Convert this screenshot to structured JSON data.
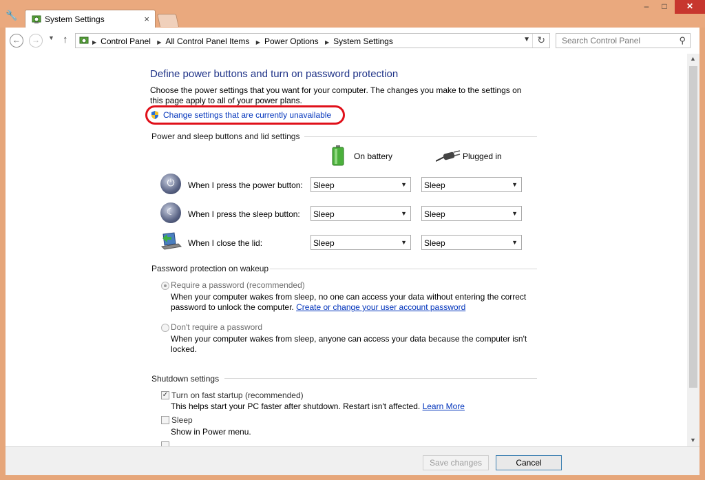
{
  "window": {
    "tab_title": "System Settings",
    "close_tab": "×",
    "minimize": "–",
    "maximize": "□",
    "close": "✕"
  },
  "nav": {
    "breadcrumbs": [
      "Control Panel",
      "All Control Panel Items",
      "Power Options",
      "System Settings"
    ],
    "search_placeholder": "Search Control Panel"
  },
  "page": {
    "heading": "Define power buttons and turn on password protection",
    "description": "Choose the power settings that you want for your computer. The changes you make to the settings on this page apply to all of your power plans.",
    "change_link": "Change settings that are currently unavailable"
  },
  "power_section": {
    "title": "Power and sleep buttons and lid settings",
    "col_battery": "On battery",
    "col_plugged": "Plugged in",
    "rows": [
      {
        "label": "When I press the power button:",
        "battery": "Sleep",
        "plugged": "Sleep"
      },
      {
        "label": "When I press the sleep button:",
        "battery": "Sleep",
        "plugged": "Sleep"
      },
      {
        "label": "When I close the lid:",
        "battery": "Sleep",
        "plugged": "Sleep"
      }
    ]
  },
  "password_section": {
    "title": "Password protection on wakeup",
    "require_label": "Require a password (recommended)",
    "require_desc": "When your computer wakes from sleep, no one can access your data without entering the correct password to unlock the computer.",
    "require_link": "Create or change your user account password",
    "norequire_label": "Don't require a password",
    "norequire_desc": "When your computer wakes from sleep, anyone can access your data because the computer isn't locked.",
    "selected": "require"
  },
  "shutdown_section": {
    "title": "Shutdown settings",
    "fast_startup_label": "Turn on fast startup (recommended)",
    "fast_startup_desc": "This helps start your PC faster after shutdown. Restart isn't affected.",
    "learn_more": "Learn More",
    "fast_startup_checked": true,
    "sleep_label": "Sleep",
    "sleep_desc": "Show in Power menu.",
    "sleep_checked": false
  },
  "buttons": {
    "save": "Save changes",
    "cancel": "Cancel"
  },
  "colors": {
    "heading": "#1e3287",
    "link": "#0033bb",
    "highlight": "#e0101a",
    "frame": "#e6a67a",
    "close_button": "#c7362e"
  }
}
